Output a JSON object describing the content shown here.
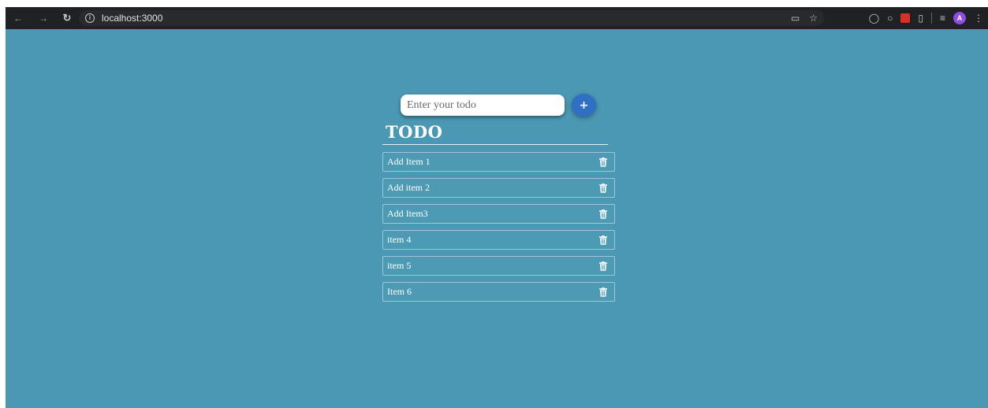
{
  "browser": {
    "url": "localhost:3000",
    "back_icon": "arrow-left-icon",
    "forward_icon": "arrow-right-icon",
    "reload_icon": "reload-icon",
    "profile_initial": "A"
  },
  "app": {
    "input": {
      "placeholder": "Enter your todo",
      "value": ""
    },
    "add_button_label": "+",
    "title": "TODO",
    "items": [
      {
        "text": "Add Item 1"
      },
      {
        "text": "Add item 2"
      },
      {
        "text": "Add Item3"
      },
      {
        "text": "item 4"
      },
      {
        "text": "item 5"
      },
      {
        "text": "Item 6"
      }
    ]
  },
  "colors": {
    "background": "#4a98b4",
    "add_button": "#2f6fc4",
    "toolbar": "#1f2124"
  }
}
